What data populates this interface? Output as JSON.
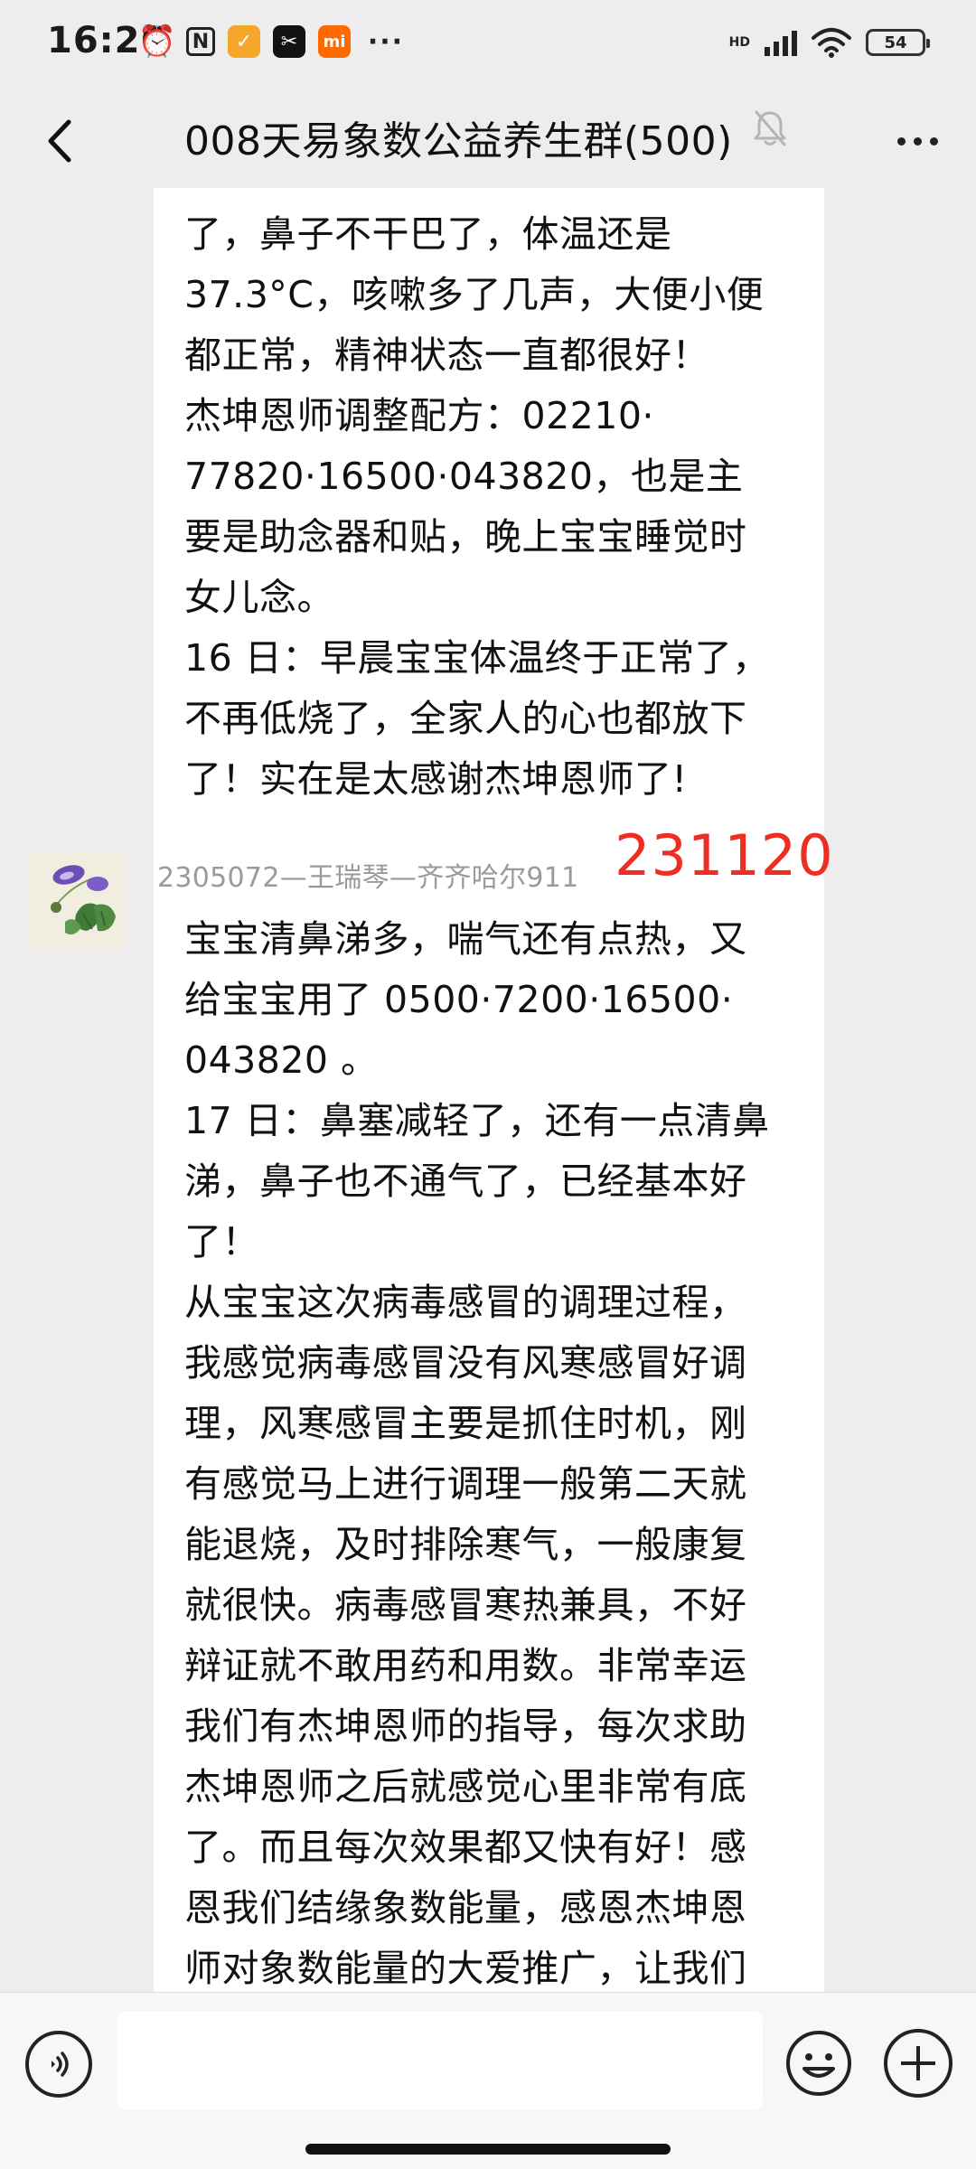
{
  "status_bar": {
    "time": "16:26",
    "network_label": "HD",
    "battery": "54"
  },
  "header": {
    "title": "008天易象数公益养生群(500)"
  },
  "messages": [
    {
      "lines": [
        "了，鼻子不干巴了，体温还是",
        "37.3°C，咳嗽多了几声，大便小便",
        "都正常，精神状态一直都很好！",
        "杰坤恩师调整配方：02210·",
        "77820·16500·043820，也是主",
        "要是助念器和贴，晚上宝宝睡觉时",
        "女儿念。",
        "16 日：早晨宝宝体温终于正常了，",
        "不再低烧了，全家人的心也都放下",
        "了！实在是太感谢杰坤恩师了!"
      ]
    },
    {
      "sender": "2305072—王瑞琴—齐齐哈尔911",
      "annotation": "231120",
      "lines": [
        "宝宝清鼻涕多，喘气还有点热，又",
        "给宝宝用了 0500·7200·16500·",
        "043820 。",
        "17 日：鼻塞减轻了，还有一点清鼻",
        "涕，鼻子也不通气了，已经基本好",
        "了！",
        "从宝宝这次病毒感冒的调理过程，",
        "我感觉病毒感冒没有风寒感冒好调",
        "理，风寒感冒主要是抓住时机，刚",
        "有感觉马上进行调理一般第二天就",
        "能退烧，及时排除寒气，一般康复",
        "就很快。病毒感冒寒热兼具，不好",
        "辩证就不敢用药和用数。非常幸运",
        "我们有杰坤恩师的指导，每次求助",
        "杰坤恩师之后就感觉心里非常有底",
        "了。而且每次效果都又快有好！感",
        "恩我们结缘象数能量，感恩杰坤恩",
        "师对象数能量的大爱推广，让我们"
      ]
    }
  ],
  "input_bar": {
    "placeholder": ""
  },
  "icons": {
    "back": "back-arrow-icon",
    "mute": "bell-off-icon",
    "more": "more-dots-icon",
    "voice": "voice-icon",
    "emoji": "emoji-icon",
    "plus": "plus-icon"
  },
  "colors": {
    "background": "#ededed",
    "bubble": "#ffffff",
    "annotation": "#ee2e22",
    "sender": "#9a9a9a"
  }
}
